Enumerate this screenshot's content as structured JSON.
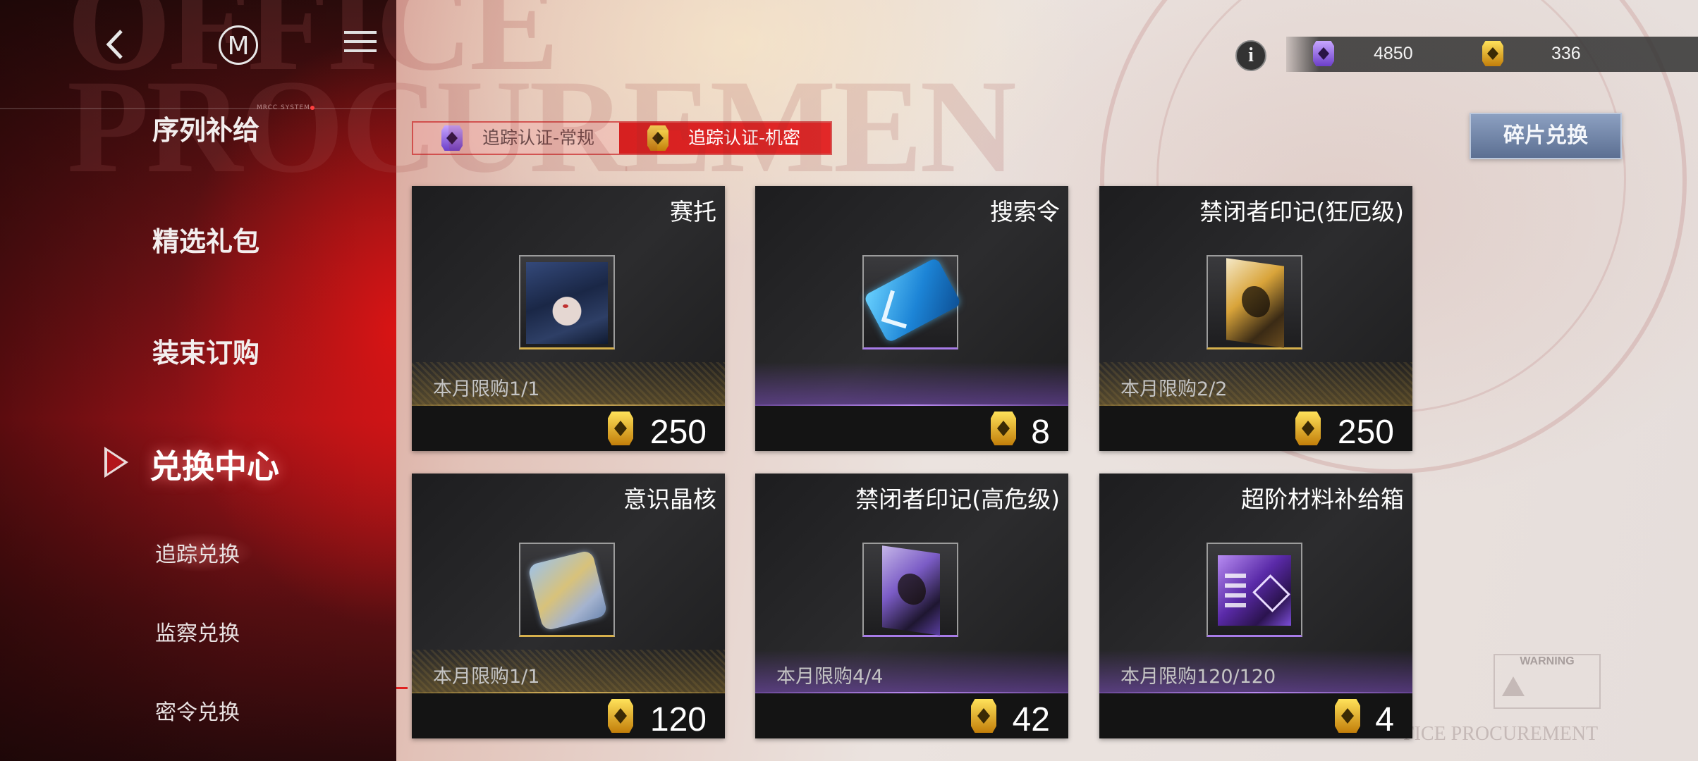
{
  "background": {
    "watermark_line1": "OFFICE",
    "watermark_line2": "PROCUREMEN",
    "warning_label": "WARNING",
    "procurement_text": "FICE PROCUREMENT"
  },
  "sidebar": {
    "system_tag": "MRCC SYSTEM",
    "menu": [
      {
        "label": "序列补给"
      },
      {
        "label": "精选礼包"
      },
      {
        "label": "装束订购"
      },
      {
        "label": "兑换中心",
        "active": true
      }
    ],
    "submenu": [
      {
        "label": "追踪兑换",
        "active": true
      },
      {
        "label": "监察兑换"
      },
      {
        "label": "密令兑换"
      }
    ]
  },
  "top_bar": {
    "back_icon": "back-arrow-icon",
    "m_logo": "M",
    "menu_icon": "menu-icon",
    "info_icon": "i",
    "currencies": [
      {
        "name": "purple-token",
        "color": "#8a5ce0",
        "amount": "4850"
      },
      {
        "name": "gold-token",
        "color": "#e0b020",
        "amount": "336"
      }
    ]
  },
  "tabs": [
    {
      "label": "追踪认证-常规",
      "icon": "purple-badge-icon",
      "active": false
    },
    {
      "label": "追踪认证-机密",
      "icon": "gold-badge-icon",
      "active": true
    }
  ],
  "shard_exchange_label": "碎片兑换",
  "items": [
    {
      "title": "赛托",
      "limit": "本月限购1/1",
      "price": "250",
      "rarity": "gold"
    },
    {
      "title": "搜索令",
      "limit": "",
      "price": "8",
      "rarity": "purple"
    },
    {
      "title": "禁闭者印记(狂厄级)",
      "limit": "本月限购2/2",
      "price": "250",
      "rarity": "gold"
    },
    {
      "title": "意识晶核",
      "limit": "本月限购1/1",
      "price": "120",
      "rarity": "gold"
    },
    {
      "title": "禁闭者印记(高危级)",
      "limit": "本月限购4/4",
      "price": "42",
      "rarity": "purple"
    },
    {
      "title": "超阶材料补给箱",
      "limit": "本月限购120/120",
      "price": "4",
      "rarity": "purple"
    }
  ],
  "colors": {
    "accent_red": "#d62020",
    "gold": "#d6b04c",
    "purple": "#a77be8",
    "card_bg": "#222224"
  }
}
